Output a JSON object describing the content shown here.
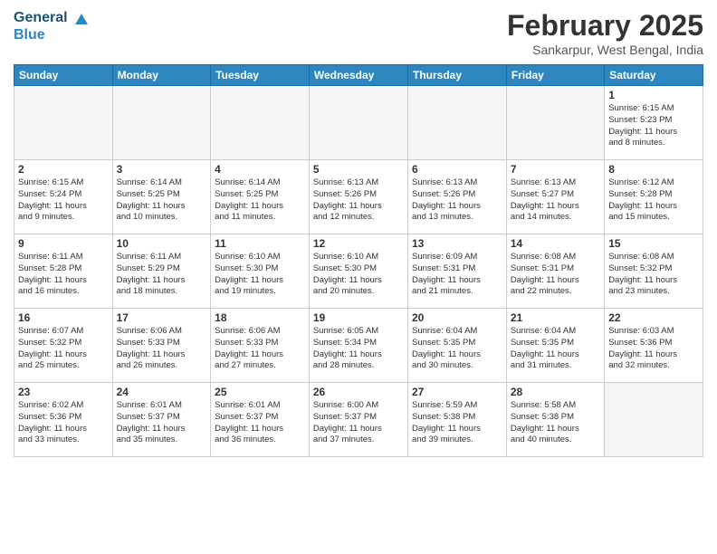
{
  "header": {
    "logo_line1": "General",
    "logo_line2": "Blue",
    "title": "February 2025",
    "location": "Sankarpur, West Bengal, India"
  },
  "weekdays": [
    "Sunday",
    "Monday",
    "Tuesday",
    "Wednesday",
    "Thursday",
    "Friday",
    "Saturday"
  ],
  "weeks": [
    [
      {
        "day": "",
        "info": ""
      },
      {
        "day": "",
        "info": ""
      },
      {
        "day": "",
        "info": ""
      },
      {
        "day": "",
        "info": ""
      },
      {
        "day": "",
        "info": ""
      },
      {
        "day": "",
        "info": ""
      },
      {
        "day": "1",
        "info": "Sunrise: 6:15 AM\nSunset: 5:23 PM\nDaylight: 11 hours\nand 8 minutes."
      }
    ],
    [
      {
        "day": "2",
        "info": "Sunrise: 6:15 AM\nSunset: 5:24 PM\nDaylight: 11 hours\nand 9 minutes."
      },
      {
        "day": "3",
        "info": "Sunrise: 6:14 AM\nSunset: 5:25 PM\nDaylight: 11 hours\nand 10 minutes."
      },
      {
        "day": "4",
        "info": "Sunrise: 6:14 AM\nSunset: 5:25 PM\nDaylight: 11 hours\nand 11 minutes."
      },
      {
        "day": "5",
        "info": "Sunrise: 6:13 AM\nSunset: 5:26 PM\nDaylight: 11 hours\nand 12 minutes."
      },
      {
        "day": "6",
        "info": "Sunrise: 6:13 AM\nSunset: 5:26 PM\nDaylight: 11 hours\nand 13 minutes."
      },
      {
        "day": "7",
        "info": "Sunrise: 6:13 AM\nSunset: 5:27 PM\nDaylight: 11 hours\nand 14 minutes."
      },
      {
        "day": "8",
        "info": "Sunrise: 6:12 AM\nSunset: 5:28 PM\nDaylight: 11 hours\nand 15 minutes."
      }
    ],
    [
      {
        "day": "9",
        "info": "Sunrise: 6:11 AM\nSunset: 5:28 PM\nDaylight: 11 hours\nand 16 minutes."
      },
      {
        "day": "10",
        "info": "Sunrise: 6:11 AM\nSunset: 5:29 PM\nDaylight: 11 hours\nand 18 minutes."
      },
      {
        "day": "11",
        "info": "Sunrise: 6:10 AM\nSunset: 5:30 PM\nDaylight: 11 hours\nand 19 minutes."
      },
      {
        "day": "12",
        "info": "Sunrise: 6:10 AM\nSunset: 5:30 PM\nDaylight: 11 hours\nand 20 minutes."
      },
      {
        "day": "13",
        "info": "Sunrise: 6:09 AM\nSunset: 5:31 PM\nDaylight: 11 hours\nand 21 minutes."
      },
      {
        "day": "14",
        "info": "Sunrise: 6:08 AM\nSunset: 5:31 PM\nDaylight: 11 hours\nand 22 minutes."
      },
      {
        "day": "15",
        "info": "Sunrise: 6:08 AM\nSunset: 5:32 PM\nDaylight: 11 hours\nand 23 minutes."
      }
    ],
    [
      {
        "day": "16",
        "info": "Sunrise: 6:07 AM\nSunset: 5:32 PM\nDaylight: 11 hours\nand 25 minutes."
      },
      {
        "day": "17",
        "info": "Sunrise: 6:06 AM\nSunset: 5:33 PM\nDaylight: 11 hours\nand 26 minutes."
      },
      {
        "day": "18",
        "info": "Sunrise: 6:06 AM\nSunset: 5:33 PM\nDaylight: 11 hours\nand 27 minutes."
      },
      {
        "day": "19",
        "info": "Sunrise: 6:05 AM\nSunset: 5:34 PM\nDaylight: 11 hours\nand 28 minutes."
      },
      {
        "day": "20",
        "info": "Sunrise: 6:04 AM\nSunset: 5:35 PM\nDaylight: 11 hours\nand 30 minutes."
      },
      {
        "day": "21",
        "info": "Sunrise: 6:04 AM\nSunset: 5:35 PM\nDaylight: 11 hours\nand 31 minutes."
      },
      {
        "day": "22",
        "info": "Sunrise: 6:03 AM\nSunset: 5:36 PM\nDaylight: 11 hours\nand 32 minutes."
      }
    ],
    [
      {
        "day": "23",
        "info": "Sunrise: 6:02 AM\nSunset: 5:36 PM\nDaylight: 11 hours\nand 33 minutes."
      },
      {
        "day": "24",
        "info": "Sunrise: 6:01 AM\nSunset: 5:37 PM\nDaylight: 11 hours\nand 35 minutes."
      },
      {
        "day": "25",
        "info": "Sunrise: 6:01 AM\nSunset: 5:37 PM\nDaylight: 11 hours\nand 36 minutes."
      },
      {
        "day": "26",
        "info": "Sunrise: 6:00 AM\nSunset: 5:37 PM\nDaylight: 11 hours\nand 37 minutes."
      },
      {
        "day": "27",
        "info": "Sunrise: 5:59 AM\nSunset: 5:38 PM\nDaylight: 11 hours\nand 39 minutes."
      },
      {
        "day": "28",
        "info": "Sunrise: 5:58 AM\nSunset: 5:38 PM\nDaylight: 11 hours\nand 40 minutes."
      },
      {
        "day": "",
        "info": ""
      }
    ]
  ]
}
